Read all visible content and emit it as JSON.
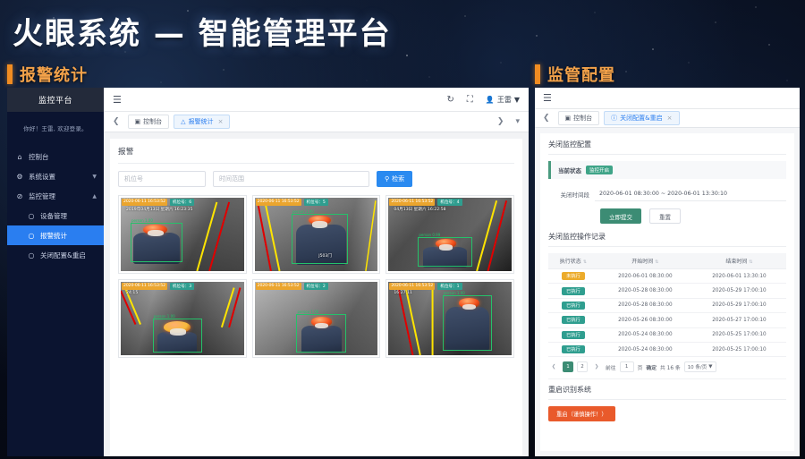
{
  "page": {
    "main_title": "火眼系统 — 智能管理平台"
  },
  "sections": {
    "left_header": "报警统计",
    "right_header": "监管配置",
    "accent_orange": "#f08c22"
  },
  "left_app": {
    "sidebar": {
      "brand": "监控平台",
      "greeting": "你好！王雷, 欢迎登录。",
      "items": [
        {
          "label": "控制台",
          "icon": "home-icon",
          "caret": "",
          "level": 0,
          "active": false
        },
        {
          "label": "系统设置",
          "icon": "gear-icon",
          "caret": "▼",
          "level": 0,
          "active": false
        },
        {
          "label": "监控管理",
          "icon": "monitor-icon",
          "caret": "▲",
          "level": 0,
          "active": false
        },
        {
          "label": "设备管理",
          "icon": "circle-icon",
          "caret": "",
          "level": 1,
          "active": false
        },
        {
          "label": "报警统计",
          "icon": "circle-icon",
          "caret": "",
          "level": 1,
          "active": true
        },
        {
          "label": "关闭配置&重启",
          "icon": "circle-icon",
          "caret": "",
          "level": 1,
          "active": false
        }
      ]
    },
    "topbar": {
      "menu_icon": "hamburger-icon",
      "refresh_icon": "refresh-icon",
      "fullscreen_icon": "fullscreen-icon",
      "user_icon": "user-icon",
      "user_name": "王雷",
      "user_caret": "▼"
    },
    "tabs": {
      "prev_icon": "chevron-left-icon",
      "next_icon": "chevron-right-icon",
      "more_icon": "chevron-down-icon",
      "items": [
        {
          "label": "控制台",
          "icon": "dashboard-icon",
          "active": false,
          "closable": false
        },
        {
          "label": "报警统计",
          "icon": "alert-icon",
          "active": true,
          "closable": true
        }
      ]
    },
    "search": {
      "legend": "报警",
      "machine_placeholder": "机位号",
      "time_placeholder": "时间范围",
      "button_label": "检索",
      "button_icon": "search-icon"
    },
    "cards": [
      {
        "timestamp": "2020-06-11 16:53:52",
        "machine": "机位号：6",
        "osd": "2019年04月13日  星期六  16:23:35",
        "osd2": "",
        "bbox_label": "person 1.00",
        "helmet_color": "#f4521d"
      },
      {
        "timestamp": "2020-06-11 16:53:52",
        "machine": "机位号：5",
        "osd": "",
        "osd2": "J503门",
        "bbox_label": "person 1.00",
        "helmet_color": "#f4521d"
      },
      {
        "timestamp": "2020-06-11 16:53:52",
        "machine": "机位号：4",
        "osd": "04月13日  星期六  16:22:58",
        "osd2": "",
        "bbox_label": "person 0.99",
        "helmet_color": "#f4521d"
      },
      {
        "timestamp": "2020-06-11 16:53:52",
        "machine": "机位号：3",
        "osd": "24:15",
        "osd2": "",
        "bbox_label": "person 1.00",
        "helmet_color": "#f6b93b"
      },
      {
        "timestamp": "2020-06-11 16:53:52",
        "machine": "机位号：2",
        "osd": "",
        "osd2": "",
        "bbox_label": "person 1.00",
        "helmet_color": "#f4521d"
      },
      {
        "timestamp": "2020-06-11 16:53:52",
        "machine": "机位号：1",
        "osd": "16:27:11",
        "osd2": "",
        "bbox_label": "person 1.00",
        "helmet_color": "#f4521d"
      }
    ]
  },
  "right_app": {
    "topbar": {
      "menu_icon": "hamburger-icon"
    },
    "tabs": {
      "prev_icon": "chevron-left-icon",
      "items": [
        {
          "label": "控制台",
          "icon": "dashboard-icon",
          "active": false,
          "closable": false
        },
        {
          "label": "关闭配置&重启",
          "icon": "power-icon",
          "active": true,
          "closable": true
        }
      ]
    },
    "config": {
      "legend": "关闭监控配置",
      "status_label": "当前状态",
      "status_badge": "监控开启",
      "period_label": "关闭时间段",
      "period_value": "2020-06-01 08:30:00 ~ 2020-06-01 13:30:10",
      "submit_label": "立即提交",
      "reset_label": "重置"
    },
    "records": {
      "legend": "关闭监控操作记录",
      "columns": [
        "执行状态",
        "开始时间",
        "结束时间"
      ],
      "rows": [
        {
          "status": "未执行",
          "state": "pending",
          "start": "2020-06-01 08:30:00",
          "end": "2020-06-01 13:30:10"
        },
        {
          "status": "已执行",
          "state": "done",
          "start": "2020-05-28 08:30:00",
          "end": "2020-05-29 17:00:10"
        },
        {
          "status": "已执行",
          "state": "done",
          "start": "2020-05-28 08:30:00",
          "end": "2020-05-29 17:00:10"
        },
        {
          "status": "已执行",
          "state": "done",
          "start": "2020-05-26 08:30:00",
          "end": "2020-05-27 17:00:10"
        },
        {
          "status": "已执行",
          "state": "done",
          "start": "2020-05-24 08:30:00",
          "end": "2020-05-25 17:00:10"
        },
        {
          "status": "已执行",
          "state": "done",
          "start": "2020-05-24 08:30:00",
          "end": "2020-05-25 17:00:10"
        }
      ]
    },
    "pagination": {
      "prev_icon": "chevron-left-icon",
      "next_icon": "chevron-right-icon",
      "pages": [
        "1",
        "2"
      ],
      "current_page": "1",
      "jump_label": "前往",
      "jump_value": "1",
      "jump_unit": "页",
      "confirm_label": "确定",
      "total_label": "共 16 条",
      "page_size": "10 条/页",
      "page_size_caret": "▼"
    },
    "restart": {
      "legend": "重启识别系统",
      "button_label": "重启（谨慎操作！）"
    }
  }
}
